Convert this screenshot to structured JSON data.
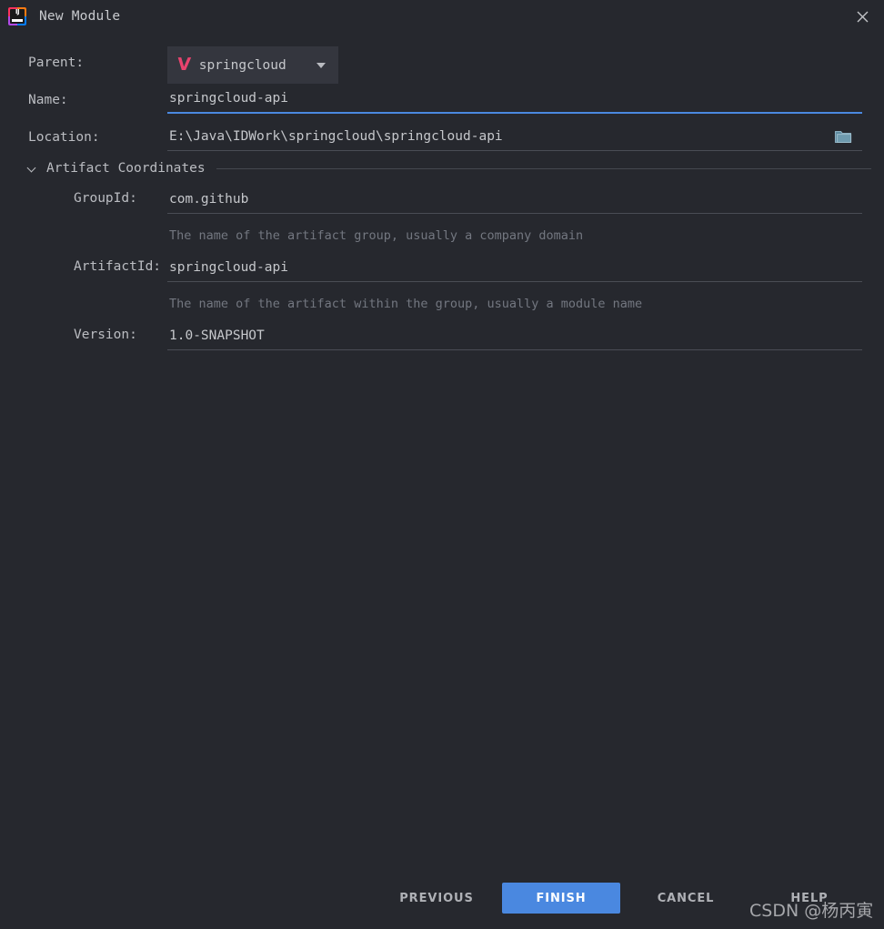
{
  "window": {
    "title": "New Module",
    "app_icon": "intellij-idea-logo",
    "close_icon": "close-icon"
  },
  "theme": {
    "background": "#26282E",
    "field_background": "#34363E",
    "text": "#C5C7CB",
    "label": "#BBBDC2",
    "hint": "#737780",
    "accent_blue": "#4A88E0",
    "maven_pink": "#E8436E",
    "folder_icon": "#5E8BA0",
    "divider": "#45484F"
  },
  "form": {
    "parent": {
      "label": "Parent:",
      "value": "springcloud",
      "icon": "maven-module-icon",
      "dropdown_icon": "chevron-down-icon"
    },
    "name": {
      "label": "Name:",
      "value": "springcloud-api",
      "placeholder": "",
      "focused": true
    },
    "location": {
      "label": "Location:",
      "value": "E:\\Java\\IDWork\\springcloud\\springcloud-api",
      "placeholder": "",
      "browse_icon": "folder-icon"
    }
  },
  "artifact_coordinates": {
    "section_title": "Artifact Coordinates",
    "expanded": true,
    "collapse_icon": "chevron-down-icon",
    "fields": [
      {
        "label": "GroupId:",
        "value": "com.github",
        "hint": "The name of the artifact group, usually a company domain"
      },
      {
        "label": "ArtifactId:",
        "value": "springcloud-api",
        "hint": "The name of the artifact within the group, usually a module name"
      },
      {
        "label": "Version:",
        "value": "1.0-SNAPSHOT",
        "hint": ""
      }
    ]
  },
  "buttons": {
    "previous": "PREVIOUS",
    "finish": "FINISH",
    "cancel": "CANCEL",
    "help": "HELP"
  },
  "watermark": {
    "text": "CSDN @杨丙寅"
  }
}
